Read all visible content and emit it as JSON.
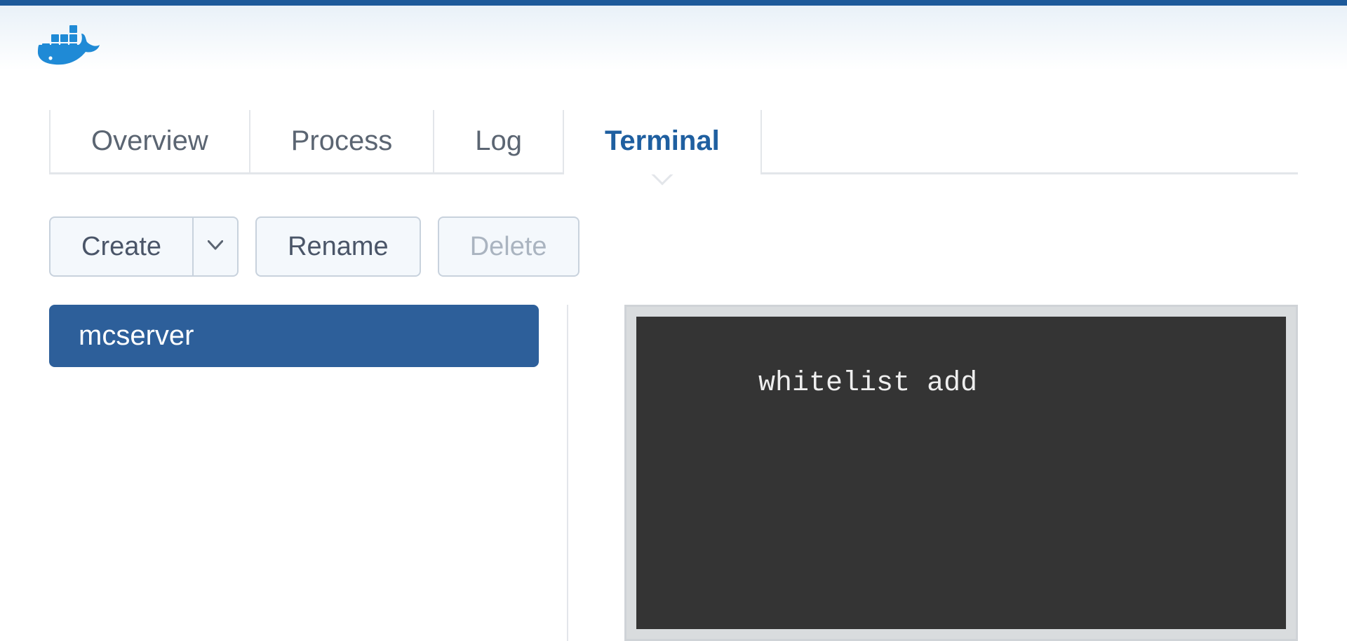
{
  "tabs": {
    "overview": "Overview",
    "process": "Process",
    "log": "Log",
    "terminal": "Terminal",
    "active": "terminal"
  },
  "toolbar": {
    "create_label": "Create",
    "rename_label": "Rename",
    "delete_label": "Delete"
  },
  "sidebar": {
    "items": [
      {
        "label": "mcserver"
      }
    ]
  },
  "terminal": {
    "content": "whitelist add"
  },
  "colors": {
    "accent": "#1f5fa0",
    "topbar": "#1d5a9a",
    "sidebar_selected": "#2d5f9a",
    "terminal_bg": "#343434"
  }
}
